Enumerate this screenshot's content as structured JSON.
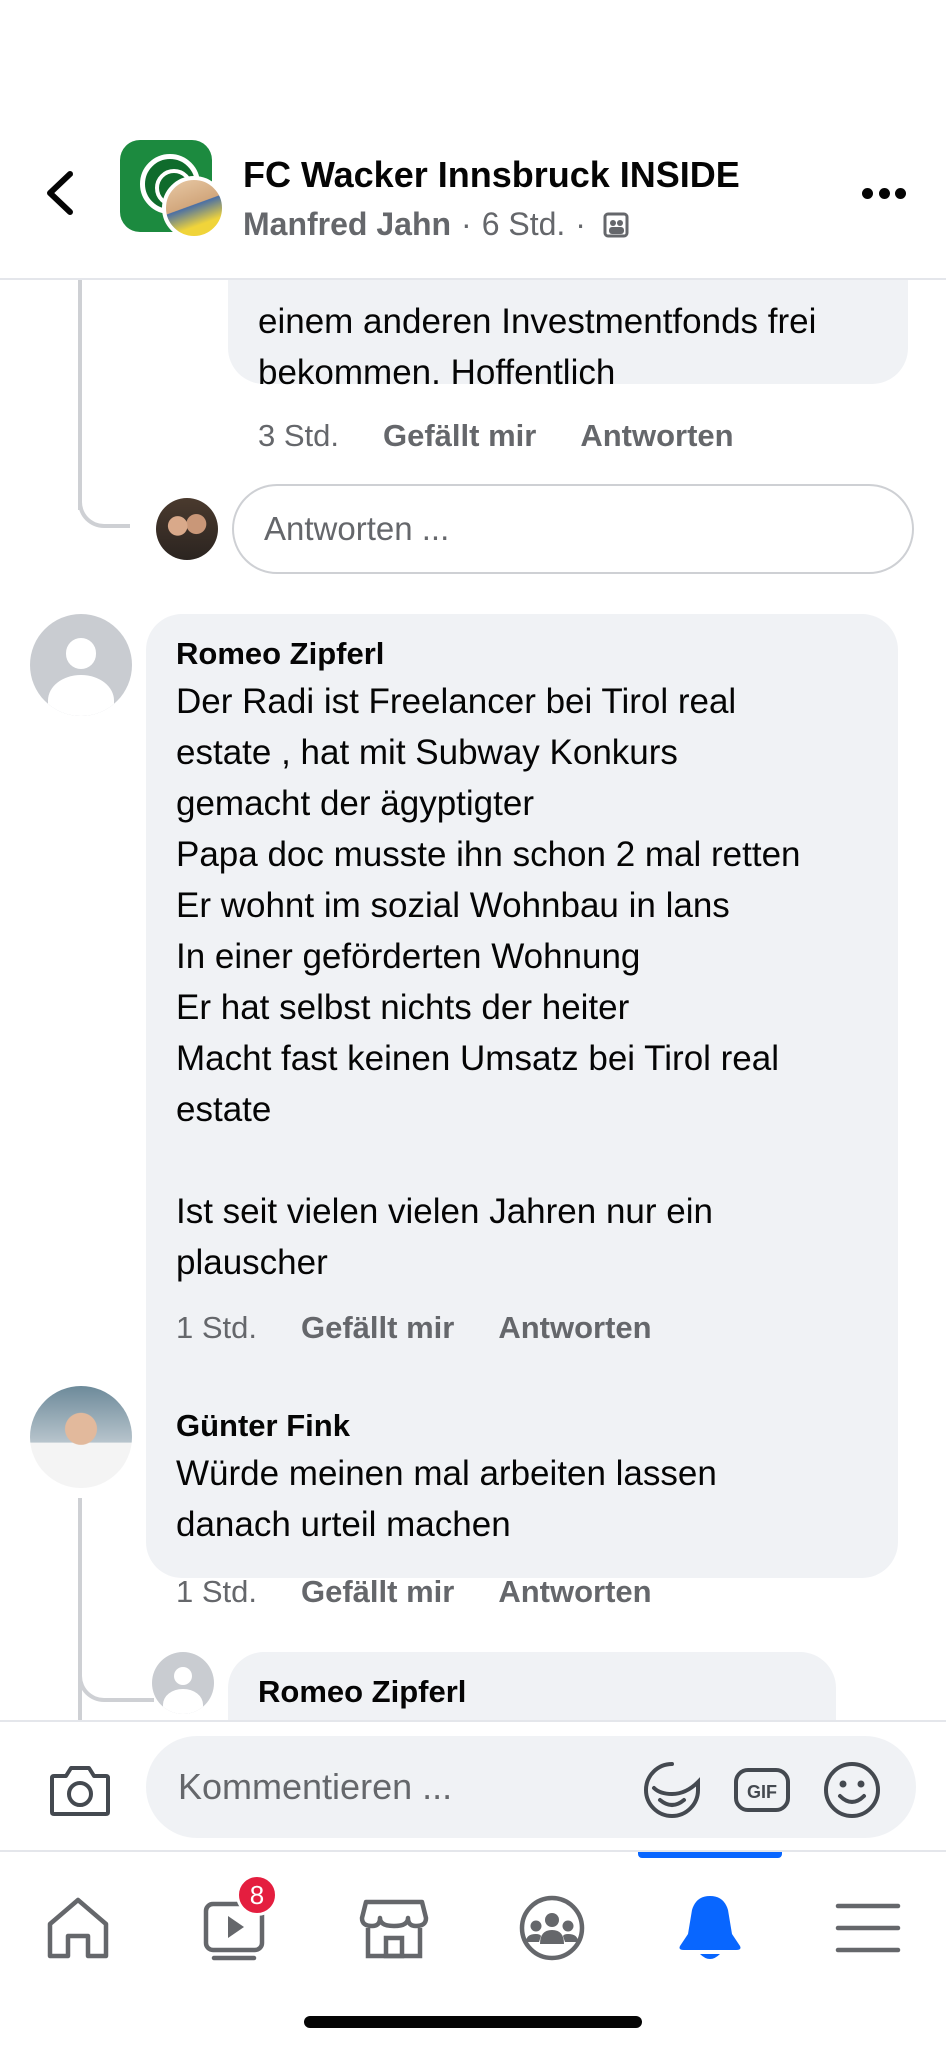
{
  "header": {
    "group_name": "FC Wacker Innsbruck INSIDE",
    "author": "Manfred Jahn",
    "separator": "·",
    "time": "6 Std."
  },
  "comments": [
    {
      "text": "einem anderen Investmentfonds frei\nbekommen. Hoffentlich",
      "time": "3 Std.",
      "like": "Gefällt mir",
      "reply": "Antworten"
    },
    {
      "author": "Romeo Zipferl",
      "text": "Der Radi ist Freelancer bei Tirol real\nestate , hat mit Subway Konkurs\ngemacht der ägyptigter\nPapa doc musste ihn schon 2 mal retten\nEr wohnt im sozial Wohnbau in lans\nIn einer geförderten Wohnung\nEr hat selbst nichts der heiter\nMacht fast keinen Umsatz bei Tirol real\nestate\n\nIst seit vielen vielen Jahren nur ein\nplauscher",
      "time": "1 Std.",
      "like": "Gefällt mir",
      "reply": "Antworten"
    },
    {
      "author": "Günter Fink",
      "text": "Würde meinen mal arbeiten lassen\ndanach urteil machen",
      "time": "1 Std.",
      "like": "Gefällt mir",
      "reply": "Antworten"
    },
    {
      "author": "Romeo Zipferl"
    }
  ],
  "reply_input": {
    "placeholder": "Antworten ..."
  },
  "composer": {
    "placeholder": "Kommentieren ...",
    "gif_label": "GIF"
  },
  "nav": {
    "badge_count": "8",
    "active_tab": "notifications",
    "accent_color": "#0866ff",
    "badge_color": "#e41e3f"
  }
}
